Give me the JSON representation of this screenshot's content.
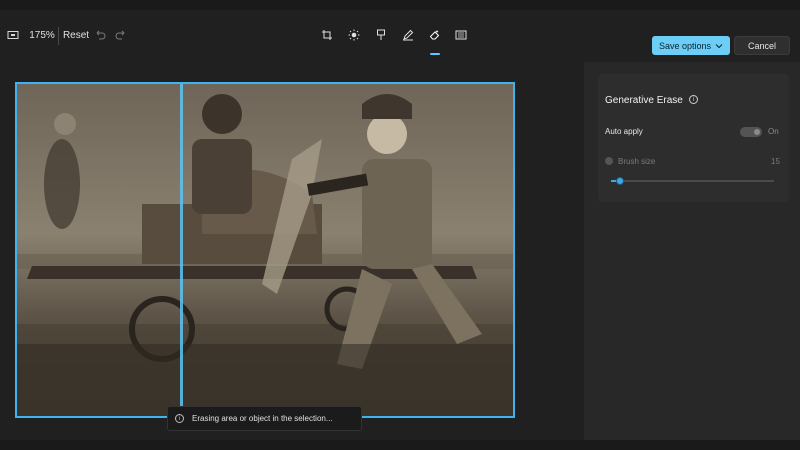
{
  "toolbar": {
    "zoom": "175%",
    "reset_label": "Reset",
    "icons": [
      "fit-screen-icon",
      "undo-icon",
      "redo-icon",
      "crop-icon",
      "brightness-icon",
      "filter-icon",
      "markup-icon",
      "erase-icon",
      "background-icon"
    ],
    "active_tool": "erase-icon"
  },
  "actions": {
    "save_label": "Save options",
    "cancel_label": "Cancel"
  },
  "panel": {
    "title": "Generative Erase",
    "auto_apply_label": "Auto apply",
    "auto_apply_state": "On",
    "brush_size_label": "Brush size",
    "brush_size_value": "15",
    "brush_size_fraction": 0.05
  },
  "toast": {
    "message": "Erasing area or object in the selection..."
  },
  "colors": {
    "accent": "#6ccef7",
    "selection_border": "#3fb3ef",
    "background": "#202020",
    "panel": "#2d2d2d"
  }
}
